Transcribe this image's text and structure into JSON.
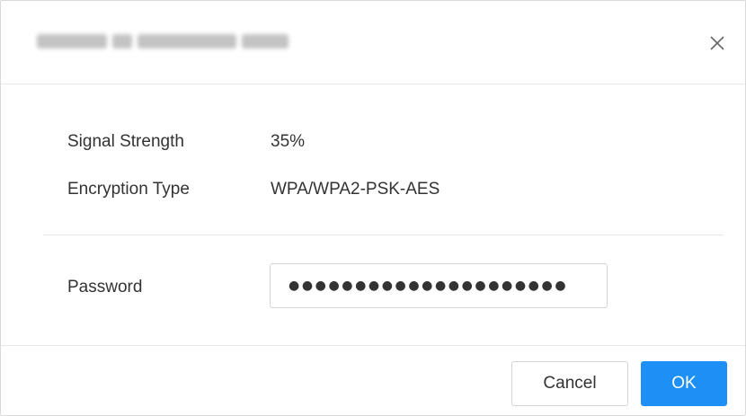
{
  "dialog": {
    "title": "Connect to Wi-Fi network (blurred)",
    "close_icon": "close-icon",
    "info": {
      "signal_label": "Signal Strength",
      "signal_value": "35%",
      "encryption_label": "Encryption Type",
      "encryption_value": "WPA/WPA2-PSK-AES"
    },
    "password": {
      "label": "Password",
      "masked_value": "●●●●●●●●●●●●●●●●●●●●●"
    },
    "footer": {
      "cancel_label": "Cancel",
      "ok_label": "OK"
    },
    "colors": {
      "primary": "#1e90f5",
      "border": "#d4d4d4",
      "divider": "#e8e8e8",
      "text": "#333333"
    }
  }
}
